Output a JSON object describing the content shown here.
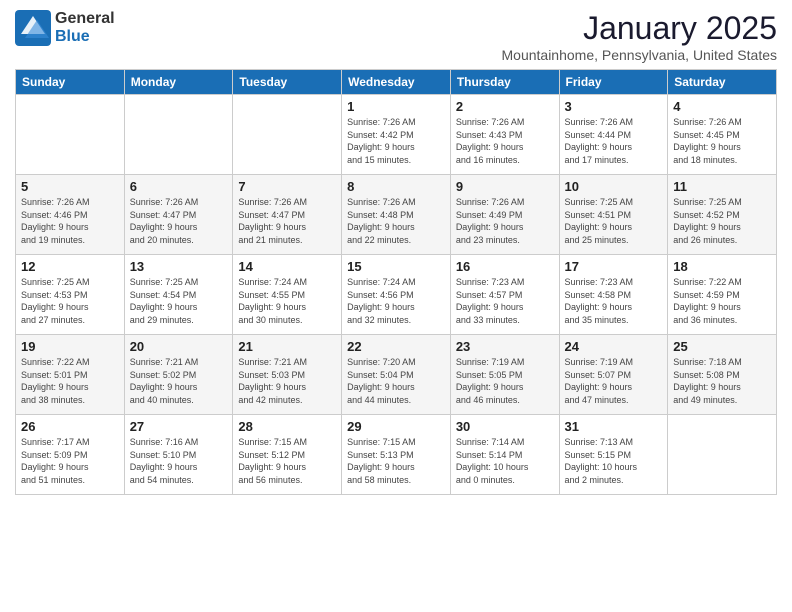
{
  "header": {
    "logo_general": "General",
    "logo_blue": "Blue",
    "month_title": "January 2025",
    "location": "Mountainhome, Pennsylvania, United States"
  },
  "weekdays": [
    "Sunday",
    "Monday",
    "Tuesday",
    "Wednesday",
    "Thursday",
    "Friday",
    "Saturday"
  ],
  "weeks": [
    {
      "days": [
        {
          "num": "",
          "info": ""
        },
        {
          "num": "",
          "info": ""
        },
        {
          "num": "",
          "info": ""
        },
        {
          "num": "1",
          "info": "Sunrise: 7:26 AM\nSunset: 4:42 PM\nDaylight: 9 hours\nand 15 minutes."
        },
        {
          "num": "2",
          "info": "Sunrise: 7:26 AM\nSunset: 4:43 PM\nDaylight: 9 hours\nand 16 minutes."
        },
        {
          "num": "3",
          "info": "Sunrise: 7:26 AM\nSunset: 4:44 PM\nDaylight: 9 hours\nand 17 minutes."
        },
        {
          "num": "4",
          "info": "Sunrise: 7:26 AM\nSunset: 4:45 PM\nDaylight: 9 hours\nand 18 minutes."
        }
      ]
    },
    {
      "days": [
        {
          "num": "5",
          "info": "Sunrise: 7:26 AM\nSunset: 4:46 PM\nDaylight: 9 hours\nand 19 minutes."
        },
        {
          "num": "6",
          "info": "Sunrise: 7:26 AM\nSunset: 4:47 PM\nDaylight: 9 hours\nand 20 minutes."
        },
        {
          "num": "7",
          "info": "Sunrise: 7:26 AM\nSunset: 4:47 PM\nDaylight: 9 hours\nand 21 minutes."
        },
        {
          "num": "8",
          "info": "Sunrise: 7:26 AM\nSunset: 4:48 PM\nDaylight: 9 hours\nand 22 minutes."
        },
        {
          "num": "9",
          "info": "Sunrise: 7:26 AM\nSunset: 4:49 PM\nDaylight: 9 hours\nand 23 minutes."
        },
        {
          "num": "10",
          "info": "Sunrise: 7:25 AM\nSunset: 4:51 PM\nDaylight: 9 hours\nand 25 minutes."
        },
        {
          "num": "11",
          "info": "Sunrise: 7:25 AM\nSunset: 4:52 PM\nDaylight: 9 hours\nand 26 minutes."
        }
      ]
    },
    {
      "days": [
        {
          "num": "12",
          "info": "Sunrise: 7:25 AM\nSunset: 4:53 PM\nDaylight: 9 hours\nand 27 minutes."
        },
        {
          "num": "13",
          "info": "Sunrise: 7:25 AM\nSunset: 4:54 PM\nDaylight: 9 hours\nand 29 minutes."
        },
        {
          "num": "14",
          "info": "Sunrise: 7:24 AM\nSunset: 4:55 PM\nDaylight: 9 hours\nand 30 minutes."
        },
        {
          "num": "15",
          "info": "Sunrise: 7:24 AM\nSunset: 4:56 PM\nDaylight: 9 hours\nand 32 minutes."
        },
        {
          "num": "16",
          "info": "Sunrise: 7:23 AM\nSunset: 4:57 PM\nDaylight: 9 hours\nand 33 minutes."
        },
        {
          "num": "17",
          "info": "Sunrise: 7:23 AM\nSunset: 4:58 PM\nDaylight: 9 hours\nand 35 minutes."
        },
        {
          "num": "18",
          "info": "Sunrise: 7:22 AM\nSunset: 4:59 PM\nDaylight: 9 hours\nand 36 minutes."
        }
      ]
    },
    {
      "days": [
        {
          "num": "19",
          "info": "Sunrise: 7:22 AM\nSunset: 5:01 PM\nDaylight: 9 hours\nand 38 minutes."
        },
        {
          "num": "20",
          "info": "Sunrise: 7:21 AM\nSunset: 5:02 PM\nDaylight: 9 hours\nand 40 minutes."
        },
        {
          "num": "21",
          "info": "Sunrise: 7:21 AM\nSunset: 5:03 PM\nDaylight: 9 hours\nand 42 minutes."
        },
        {
          "num": "22",
          "info": "Sunrise: 7:20 AM\nSunset: 5:04 PM\nDaylight: 9 hours\nand 44 minutes."
        },
        {
          "num": "23",
          "info": "Sunrise: 7:19 AM\nSunset: 5:05 PM\nDaylight: 9 hours\nand 46 minutes."
        },
        {
          "num": "24",
          "info": "Sunrise: 7:19 AM\nSunset: 5:07 PM\nDaylight: 9 hours\nand 47 minutes."
        },
        {
          "num": "25",
          "info": "Sunrise: 7:18 AM\nSunset: 5:08 PM\nDaylight: 9 hours\nand 49 minutes."
        }
      ]
    },
    {
      "days": [
        {
          "num": "26",
          "info": "Sunrise: 7:17 AM\nSunset: 5:09 PM\nDaylight: 9 hours\nand 51 minutes."
        },
        {
          "num": "27",
          "info": "Sunrise: 7:16 AM\nSunset: 5:10 PM\nDaylight: 9 hours\nand 54 minutes."
        },
        {
          "num": "28",
          "info": "Sunrise: 7:15 AM\nSunset: 5:12 PM\nDaylight: 9 hours\nand 56 minutes."
        },
        {
          "num": "29",
          "info": "Sunrise: 7:15 AM\nSunset: 5:13 PM\nDaylight: 9 hours\nand 58 minutes."
        },
        {
          "num": "30",
          "info": "Sunrise: 7:14 AM\nSunset: 5:14 PM\nDaylight: 10 hours\nand 0 minutes."
        },
        {
          "num": "31",
          "info": "Sunrise: 7:13 AM\nSunset: 5:15 PM\nDaylight: 10 hours\nand 2 minutes."
        },
        {
          "num": "",
          "info": ""
        }
      ]
    }
  ]
}
